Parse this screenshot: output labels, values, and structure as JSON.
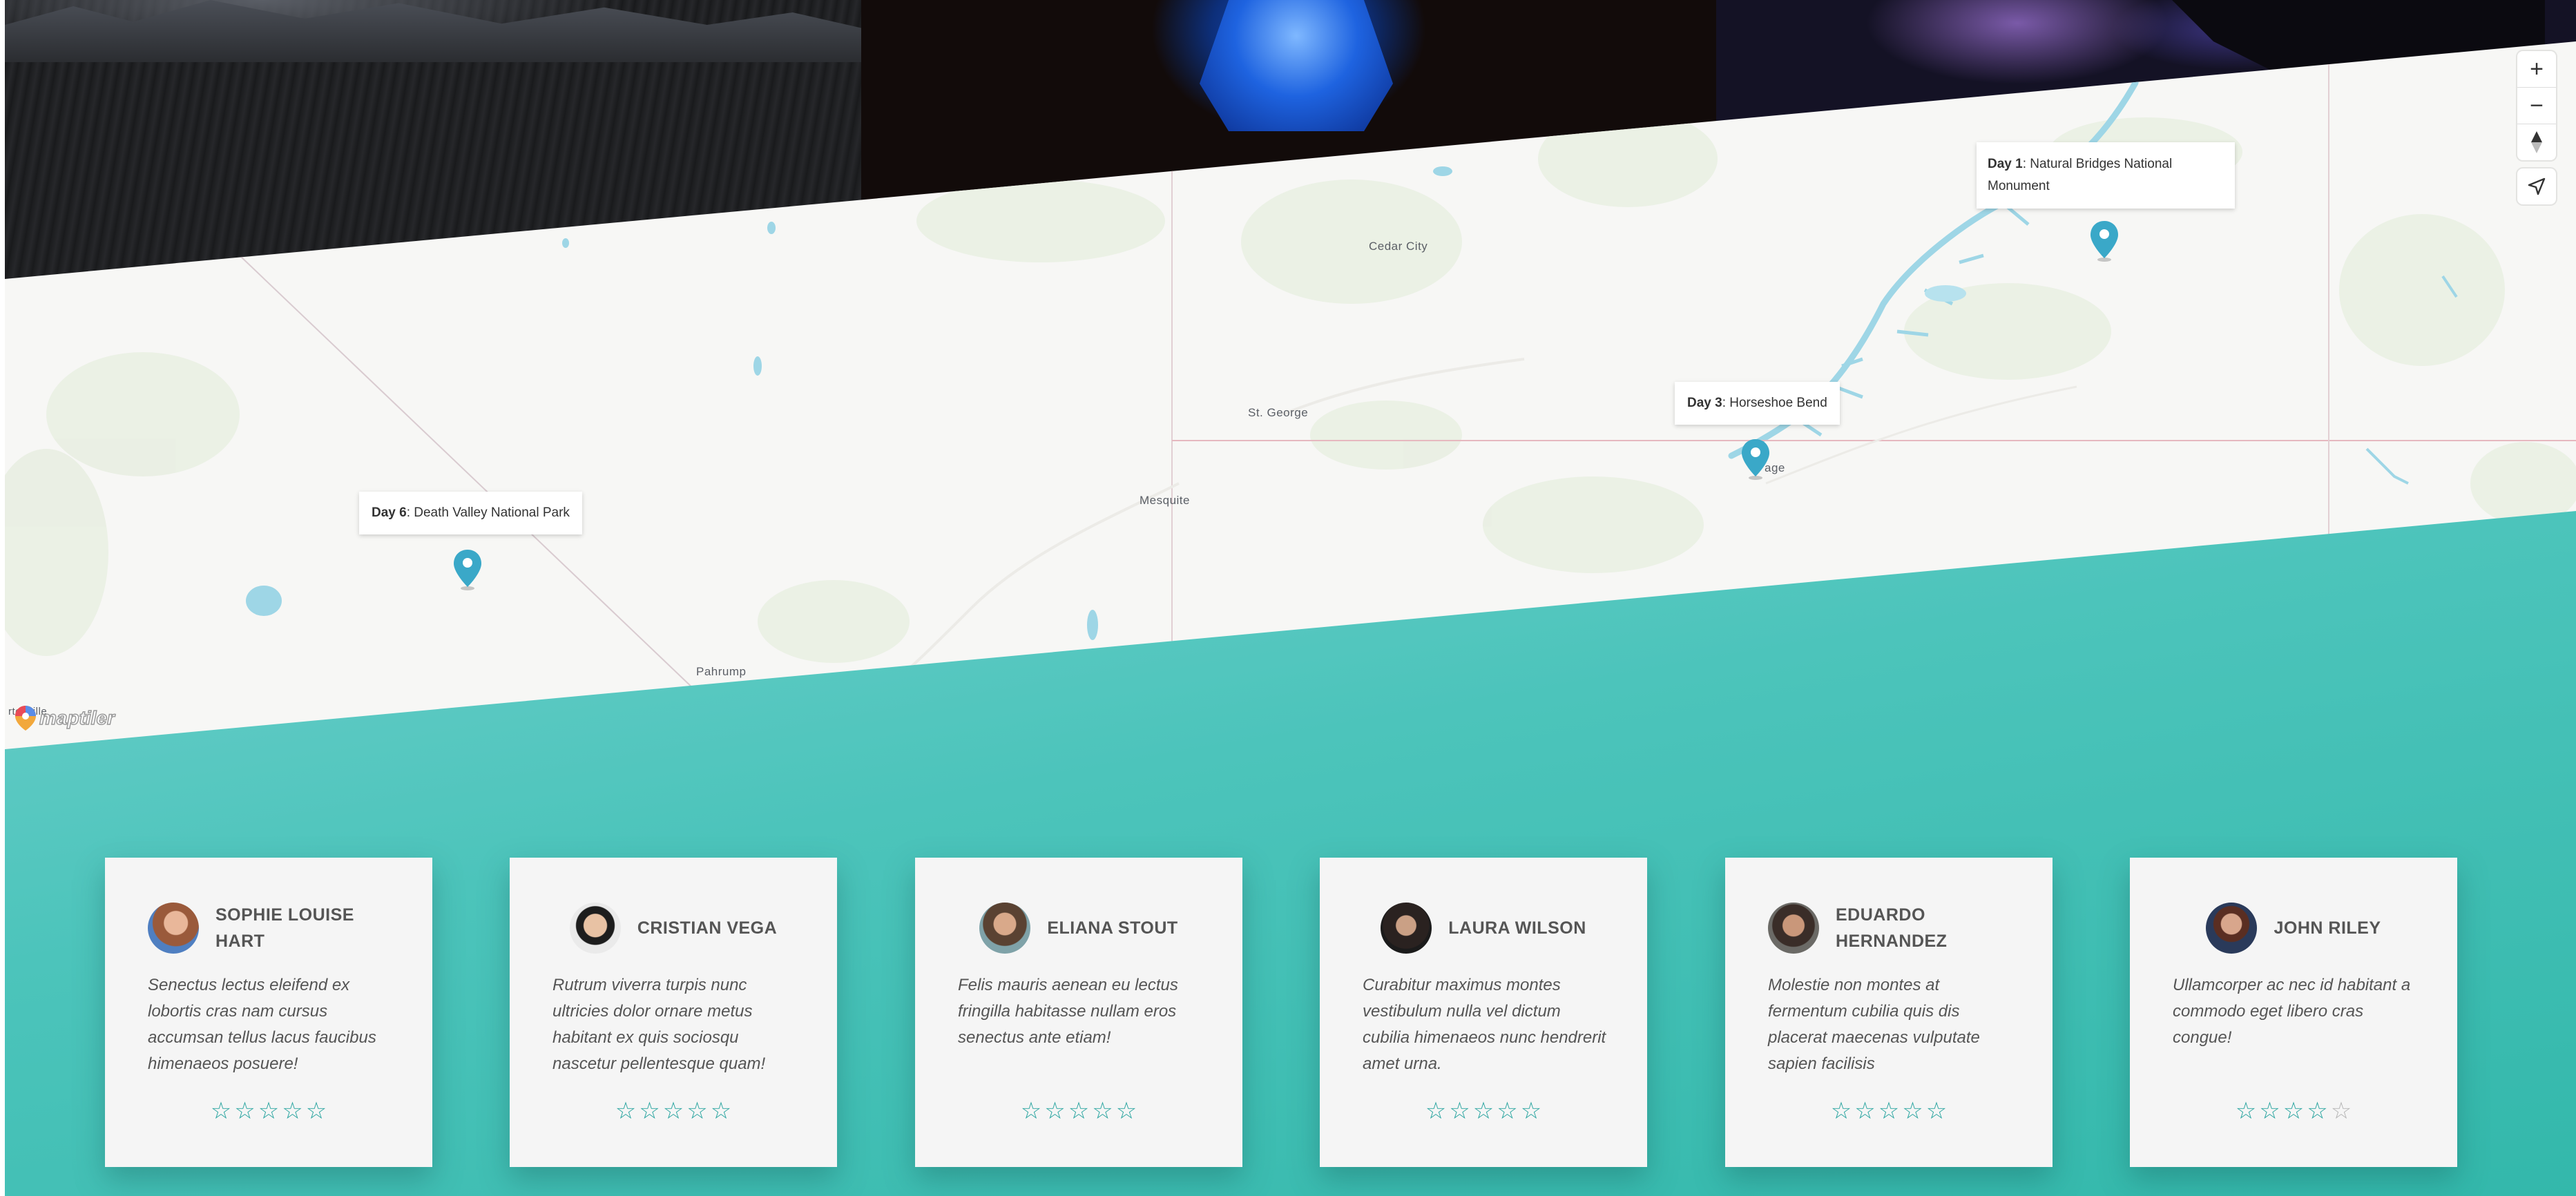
{
  "photos": [
    {
      "name": "desert-playa-at-night"
    },
    {
      "name": "blue-tent-at-night"
    },
    {
      "name": "milky-way-night-sky"
    }
  ],
  "map": {
    "place_labels": [
      {
        "id": "cedar-city",
        "text": "Cedar City"
      },
      {
        "id": "st-george",
        "text": "St. George"
      },
      {
        "id": "mesquite",
        "text": "Mesquite"
      },
      {
        "id": "pahrump",
        "text": "Pahrump"
      },
      {
        "id": "page",
        "text": "age"
      },
      {
        "id": "beatty",
        "text": "rtenville"
      }
    ],
    "markers": [
      {
        "day": "Day 1",
        "place": ": Natural Bridges National",
        "place_line2": "Monument"
      },
      {
        "day": "Day 3",
        "place": ": Horseshoe Bend"
      },
      {
        "day": "Day 6",
        "place": ": Death Valley National Park"
      }
    ],
    "controls": {
      "zoom_in": "+",
      "zoom_out": "−",
      "compass_icon": "compass-icon",
      "geolocate_icon": "geolocate-arrow-icon"
    },
    "attribution_logo": "maptiler",
    "colors": {
      "land": "#f7f7f5",
      "water": "#9ed6e6",
      "marker": "#3aa8c8",
      "state_border": "#e6b8bf"
    }
  },
  "testimonials": [
    {
      "name": "SOPHIE LOUISE HART",
      "quote": "Senectus lectus eleifend ex lobortis cras nam cursus accumsan tellus lacus faucibus himenaeos posuere!",
      "rating": 5
    },
    {
      "name": "CRISTIAN VEGA",
      "quote": "Rutrum viverra turpis nunc ultricies dolor ornare metus habitant ex quis sociosqu nascetur pellentesque quam!",
      "rating": 5
    },
    {
      "name": "ELIANA STOUT",
      "quote": "Felis mauris aenean eu lectus fringilla habitasse nullam eros senectus ante etiam!",
      "rating": 5
    },
    {
      "name": "LAURA WILSON",
      "quote": "Curabitur maximus montes vestibulum nulla vel dictum cubilia himenaeos nunc hendrerit amet urna.",
      "rating": 5
    },
    {
      "name": "EDUARDO HERNANDEZ",
      "quote": "Molestie non montes at fermentum cubilia quis dis placerat maecenas vulputate sapien facilisis",
      "rating": 5
    },
    {
      "name": "JOHN RILEY",
      "quote": "Ullamcorper ac nec id habitant a commodo eget libero cras congue!",
      "rating": 4
    }
  ],
  "colors": {
    "teal_band": "#40bfb4",
    "star": "#2aa5a0",
    "card_bg": "#f5f5f5"
  }
}
